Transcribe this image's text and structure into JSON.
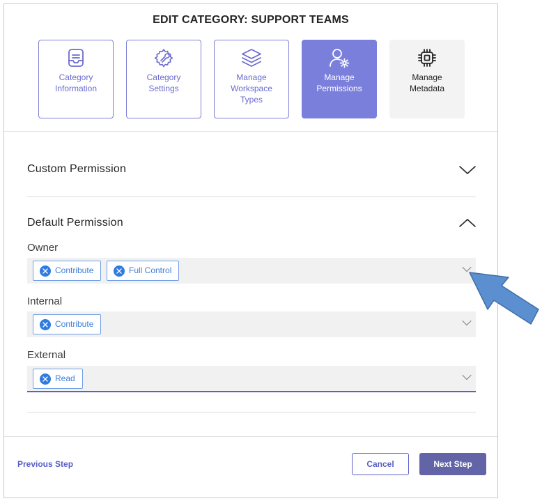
{
  "dialog": {
    "title": "EDIT CATEGORY: SUPPORT TEAMS"
  },
  "steps": [
    {
      "label_line1": "Category",
      "label_line2": "Information",
      "label_line3": "",
      "icon": "inbox-icon",
      "state": "default"
    },
    {
      "label_line1": "Category",
      "label_line2": "Settings",
      "label_line3": "",
      "icon": "gear-wrench-icon",
      "state": "default"
    },
    {
      "label_line1": "Manage",
      "label_line2": "Workspace",
      "label_line3": "Types",
      "icon": "layers-icon",
      "state": "default"
    },
    {
      "label_line1": "Manage",
      "label_line2": "Permissions",
      "label_line3": "",
      "icon": "person-gear-icon",
      "state": "active"
    },
    {
      "label_line1": "Manage",
      "label_line2": "Metadata",
      "label_line3": "",
      "icon": "chip-icon",
      "state": "disabled"
    }
  ],
  "sections": {
    "custom": {
      "title": "Custom Permission",
      "expanded": false
    },
    "default": {
      "title": "Default Permission",
      "expanded": true
    }
  },
  "fields": {
    "owner": {
      "label": "Owner",
      "chips": [
        "Contribute",
        "Full Control"
      ]
    },
    "internal": {
      "label": "Internal",
      "chips": [
        "Contribute"
      ]
    },
    "external": {
      "label": "External",
      "chips": [
        "Read"
      ]
    }
  },
  "footer": {
    "previous": "Previous Step",
    "cancel": "Cancel",
    "next": "Next Step"
  },
  "colors": {
    "accent": "#5b5fc7",
    "step_active": "#7b7fdc",
    "chip_text": "#3f7fd8",
    "annotation_arrow": "#5b8fd0"
  }
}
